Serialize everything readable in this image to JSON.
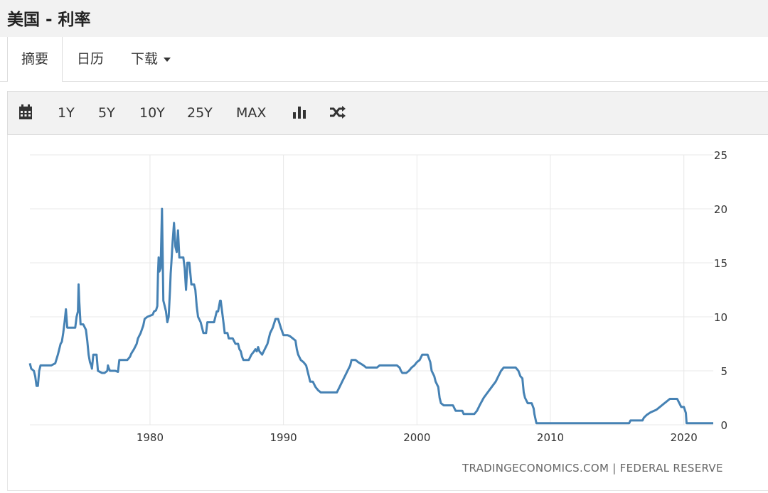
{
  "header": {
    "title": "美国 - 利率"
  },
  "tabs": [
    {
      "label": "摘要",
      "active": true
    },
    {
      "label": "日历",
      "active": false
    },
    {
      "label": "下载",
      "active": false,
      "dropdown": true
    }
  ],
  "toolbar": {
    "items": [
      {
        "icon": "calendar-icon"
      },
      {
        "label": "1Y"
      },
      {
        "label": "5Y"
      },
      {
        "label": "10Y"
      },
      {
        "label": "25Y"
      },
      {
        "label": "MAX"
      },
      {
        "icon": "bar-chart-icon"
      },
      {
        "icon": "shuffle-icon"
      }
    ]
  },
  "colors": {
    "line": "#4682b4",
    "grid": "#e8e8e8",
    "toolbar_bg": "#f2f2f2",
    "title_bg": "#f2f2f2"
  },
  "credit": "TRADINGECONOMICS.COM | FEDERAL RESERVE",
  "chart_data": {
    "type": "line",
    "title": "",
    "xlabel": "",
    "ylabel": "",
    "x_ticks": [
      1980,
      1990,
      2000,
      2010,
      2020
    ],
    "y_ticks": [
      0,
      5,
      10,
      15,
      20,
      25
    ],
    "xlim": [
      1971,
      2022.2
    ],
    "ylim": [
      0,
      25
    ],
    "y_axis_position": "right",
    "grid": true,
    "legend": "none",
    "series": [
      {
        "color": "#4682b4",
        "points": [
          [
            1971.0,
            5.7
          ],
          [
            1971.1,
            5.2
          ],
          [
            1971.3,
            5.0
          ],
          [
            1971.4,
            4.5
          ],
          [
            1971.5,
            3.6
          ],
          [
            1971.6,
            3.6
          ],
          [
            1971.7,
            5.0
          ],
          [
            1971.8,
            5.5
          ],
          [
            1972.0,
            5.5
          ],
          [
            1972.3,
            5.5
          ],
          [
            1972.6,
            5.5
          ],
          [
            1972.9,
            5.7
          ],
          [
            1973.1,
            6.5
          ],
          [
            1973.3,
            7.5
          ],
          [
            1973.4,
            7.7
          ],
          [
            1973.5,
            8.5
          ],
          [
            1973.6,
            9.5
          ],
          [
            1973.7,
            10.7
          ],
          [
            1973.8,
            9.0
          ],
          [
            1974.0,
            9.0
          ],
          [
            1974.2,
            9.0
          ],
          [
            1974.4,
            9.0
          ],
          [
            1974.5,
            10.0
          ],
          [
            1974.6,
            10.5
          ],
          [
            1974.65,
            13.0
          ],
          [
            1974.7,
            11.5
          ],
          [
            1974.8,
            9.3
          ],
          [
            1975.0,
            9.3
          ],
          [
            1975.2,
            8.8
          ],
          [
            1975.3,
            7.8
          ],
          [
            1975.4,
            6.5
          ],
          [
            1975.5,
            5.8
          ],
          [
            1975.6,
            5.5
          ],
          [
            1975.65,
            5.2
          ],
          [
            1975.75,
            6.5
          ],
          [
            1976.0,
            6.5
          ],
          [
            1976.1,
            5.0
          ],
          [
            1976.4,
            4.8
          ],
          [
            1976.6,
            4.8
          ],
          [
            1976.8,
            5.0
          ],
          [
            1976.85,
            5.5
          ],
          [
            1976.9,
            5.3
          ],
          [
            1977.0,
            5.0
          ],
          [
            1977.2,
            5.0
          ],
          [
            1977.4,
            5.0
          ],
          [
            1977.6,
            4.9
          ],
          [
            1977.7,
            6.0
          ],
          [
            1978.0,
            6.0
          ],
          [
            1978.3,
            6.0
          ],
          [
            1978.5,
            6.3
          ],
          [
            1978.6,
            6.6
          ],
          [
            1978.8,
            7.0
          ],
          [
            1979.0,
            7.5
          ],
          [
            1979.1,
            8.0
          ],
          [
            1979.3,
            8.5
          ],
          [
            1979.5,
            9.2
          ],
          [
            1979.6,
            9.8
          ],
          [
            1979.8,
            10.0
          ],
          [
            1980.0,
            10.1
          ],
          [
            1980.2,
            10.2
          ],
          [
            1980.3,
            10.5
          ],
          [
            1980.45,
            10.6
          ],
          [
            1980.55,
            11.0
          ],
          [
            1980.6,
            14.0
          ],
          [
            1980.65,
            15.5
          ],
          [
            1980.7,
            14.2
          ],
          [
            1980.8,
            14.5
          ],
          [
            1980.9,
            20.0
          ],
          [
            1981.0,
            11.5
          ],
          [
            1981.1,
            11.0
          ],
          [
            1981.2,
            10.5
          ],
          [
            1981.3,
            9.5
          ],
          [
            1981.4,
            10.0
          ],
          [
            1981.5,
            12.5
          ],
          [
            1981.55,
            14.0
          ],
          [
            1981.6,
            15.0
          ],
          [
            1981.7,
            17.0
          ],
          [
            1981.8,
            18.7
          ],
          [
            1981.9,
            16.5
          ],
          [
            1982.0,
            16.0
          ],
          [
            1982.1,
            18.0
          ],
          [
            1982.2,
            15.5
          ],
          [
            1982.3,
            15.5
          ],
          [
            1982.5,
            15.5
          ],
          [
            1982.6,
            14.5
          ],
          [
            1982.7,
            12.5
          ],
          [
            1982.8,
            15.0
          ],
          [
            1982.95,
            15.0
          ],
          [
            1983.1,
            13.0
          ],
          [
            1983.3,
            13.0
          ],
          [
            1983.4,
            12.5
          ],
          [
            1983.5,
            11.0
          ],
          [
            1983.6,
            10.0
          ],
          [
            1983.8,
            9.5
          ],
          [
            1984.0,
            8.5
          ],
          [
            1984.2,
            8.5
          ],
          [
            1984.3,
            9.5
          ],
          [
            1984.6,
            9.5
          ],
          [
            1984.7,
            9.5
          ],
          [
            1984.8,
            9.5
          ],
          [
            1984.9,
            10.0
          ],
          [
            1985.0,
            10.5
          ],
          [
            1985.1,
            10.5
          ],
          [
            1985.25,
            11.5
          ],
          [
            1985.3,
            11.5
          ],
          [
            1985.4,
            10.5
          ],
          [
            1985.5,
            9.5
          ],
          [
            1985.6,
            8.5
          ],
          [
            1985.7,
            8.5
          ],
          [
            1985.8,
            8.5
          ],
          [
            1985.9,
            8.0
          ],
          [
            1986.0,
            8.0
          ],
          [
            1986.2,
            8.0
          ],
          [
            1986.4,
            7.5
          ],
          [
            1986.6,
            7.5
          ],
          [
            1986.7,
            7.0
          ],
          [
            1986.8,
            6.8
          ],
          [
            1986.9,
            6.3
          ],
          [
            1987.0,
            6.0
          ],
          [
            1987.2,
            6.0
          ],
          [
            1987.4,
            6.0
          ],
          [
            1987.6,
            6.5
          ],
          [
            1987.8,
            6.8
          ],
          [
            1987.9,
            7.0
          ],
          [
            1988.0,
            6.8
          ],
          [
            1988.1,
            7.2
          ],
          [
            1988.2,
            6.8
          ],
          [
            1988.4,
            6.5
          ],
          [
            1988.6,
            7.0
          ],
          [
            1988.8,
            7.5
          ],
          [
            1988.9,
            8.0
          ],
          [
            1989.0,
            8.5
          ],
          [
            1989.2,
            9.0
          ],
          [
            1989.4,
            9.8
          ],
          [
            1989.6,
            9.8
          ],
          [
            1989.8,
            9.0
          ],
          [
            1990.0,
            8.3
          ],
          [
            1990.3,
            8.3
          ],
          [
            1990.5,
            8.2
          ],
          [
            1990.7,
            8.0
          ],
          [
            1990.9,
            7.8
          ],
          [
            1991.0,
            7.0
          ],
          [
            1991.1,
            6.5
          ],
          [
            1991.3,
            6.0
          ],
          [
            1991.5,
            5.8
          ],
          [
            1991.7,
            5.5
          ],
          [
            1991.8,
            5.0
          ],
          [
            1991.9,
            4.5
          ],
          [
            1992.0,
            4.0
          ],
          [
            1992.2,
            4.0
          ],
          [
            1992.4,
            3.5
          ],
          [
            1992.6,
            3.2
          ],
          [
            1992.8,
            3.0
          ],
          [
            1993.0,
            3.0
          ],
          [
            1993.5,
            3.0
          ],
          [
            1994.0,
            3.0
          ],
          [
            1994.2,
            3.5
          ],
          [
            1994.4,
            4.0
          ],
          [
            1994.6,
            4.5
          ],
          [
            1994.8,
            5.0
          ],
          [
            1995.0,
            5.5
          ],
          [
            1995.1,
            6.0
          ],
          [
            1995.4,
            6.0
          ],
          [
            1995.6,
            5.8
          ],
          [
            1996.0,
            5.5
          ],
          [
            1996.2,
            5.3
          ],
          [
            1996.6,
            5.3
          ],
          [
            1997.0,
            5.3
          ],
          [
            1997.2,
            5.5
          ],
          [
            1997.6,
            5.5
          ],
          [
            1998.0,
            5.5
          ],
          [
            1998.5,
            5.5
          ],
          [
            1998.7,
            5.3
          ],
          [
            1998.8,
            5.0
          ],
          [
            1998.9,
            4.8
          ],
          [
            1999.2,
            4.8
          ],
          [
            1999.4,
            5.0
          ],
          [
            1999.6,
            5.3
          ],
          [
            1999.8,
            5.5
          ],
          [
            2000.0,
            5.8
          ],
          [
            2000.2,
            6.0
          ],
          [
            2000.4,
            6.5
          ],
          [
            2000.6,
            6.5
          ],
          [
            2000.8,
            6.5
          ],
          [
            2001.0,
            5.8
          ],
          [
            2001.1,
            5.0
          ],
          [
            2001.3,
            4.5
          ],
          [
            2001.4,
            4.0
          ],
          [
            2001.6,
            3.5
          ],
          [
            2001.7,
            2.5
          ],
          [
            2001.8,
            2.0
          ],
          [
            2002.0,
            1.8
          ],
          [
            2002.4,
            1.8
          ],
          [
            2002.7,
            1.8
          ],
          [
            2002.9,
            1.3
          ],
          [
            2003.0,
            1.3
          ],
          [
            2003.4,
            1.3
          ],
          [
            2003.5,
            1.0
          ],
          [
            2004.0,
            1.0
          ],
          [
            2004.3,
            1.0
          ],
          [
            2004.5,
            1.3
          ],
          [
            2004.7,
            1.8
          ],
          [
            2005.0,
            2.5
          ],
          [
            2005.3,
            3.0
          ],
          [
            2005.6,
            3.5
          ],
          [
            2005.9,
            4.0
          ],
          [
            2006.1,
            4.5
          ],
          [
            2006.3,
            5.0
          ],
          [
            2006.5,
            5.3
          ],
          [
            2007.0,
            5.3
          ],
          [
            2007.4,
            5.3
          ],
          [
            2007.6,
            5.0
          ],
          [
            2007.75,
            4.5
          ],
          [
            2007.9,
            4.3
          ],
          [
            2008.0,
            3.0
          ],
          [
            2008.1,
            2.5
          ],
          [
            2008.3,
            2.0
          ],
          [
            2008.6,
            2.0
          ],
          [
            2008.75,
            1.5
          ],
          [
            2008.8,
            1.0
          ],
          [
            2008.95,
            0.15
          ],
          [
            2010.0,
            0.15
          ],
          [
            2012.0,
            0.15
          ],
          [
            2014.0,
            0.15
          ],
          [
            2015.9,
            0.15
          ],
          [
            2016.0,
            0.4
          ],
          [
            2016.9,
            0.4
          ],
          [
            2017.0,
            0.65
          ],
          [
            2017.2,
            0.9
          ],
          [
            2017.5,
            1.15
          ],
          [
            2017.95,
            1.4
          ],
          [
            2018.2,
            1.65
          ],
          [
            2018.45,
            1.9
          ],
          [
            2018.7,
            2.15
          ],
          [
            2018.95,
            2.4
          ],
          [
            2019.5,
            2.4
          ],
          [
            2019.6,
            2.15
          ],
          [
            2019.7,
            1.9
          ],
          [
            2019.8,
            1.65
          ],
          [
            2020.0,
            1.65
          ],
          [
            2020.15,
            1.1
          ],
          [
            2020.2,
            0.15
          ],
          [
            2021.0,
            0.15
          ],
          [
            2022.0,
            0.15
          ],
          [
            2022.2,
            0.15
          ]
        ]
      }
    ]
  }
}
